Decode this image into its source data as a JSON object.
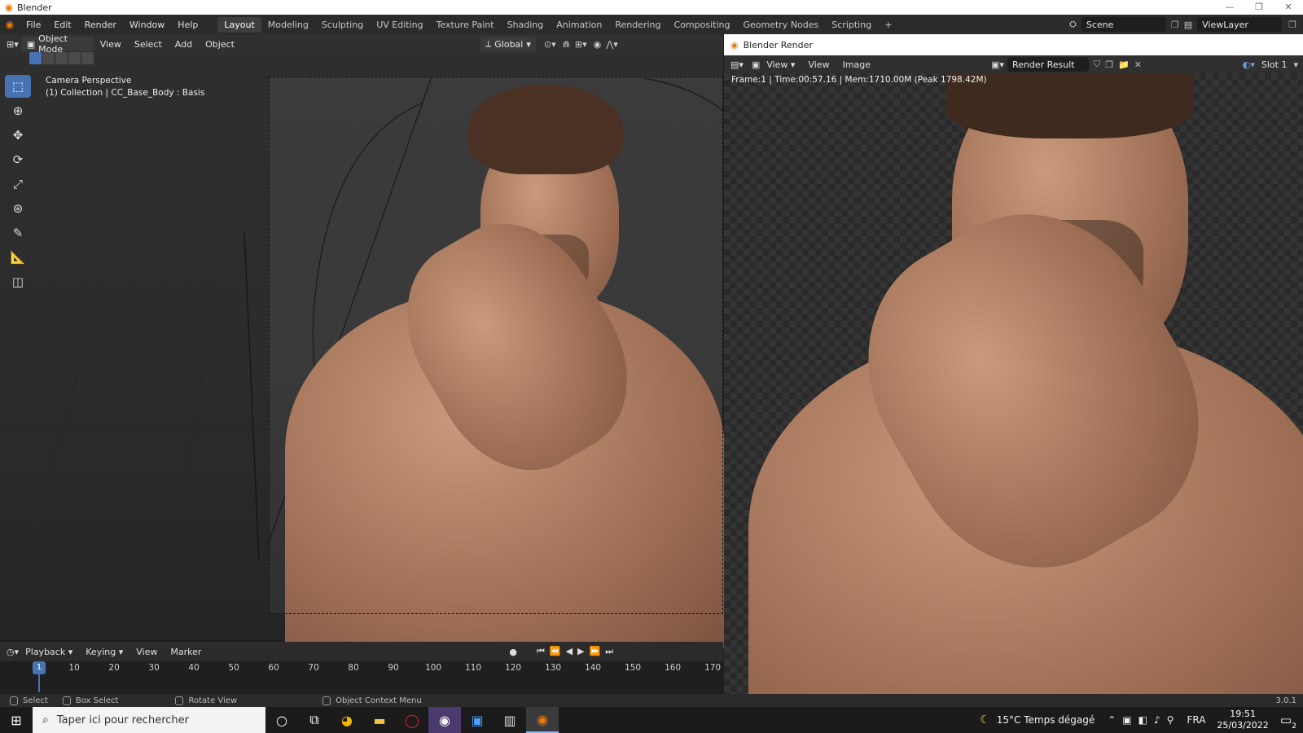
{
  "window": {
    "title": "Blender",
    "minimize": "—",
    "maximize": "❐",
    "close": "✕"
  },
  "menu": [
    "File",
    "Edit",
    "Render",
    "Window",
    "Help"
  ],
  "workspaces": [
    "Layout",
    "Modeling",
    "Sculpting",
    "UV Editing",
    "Texture Paint",
    "Shading",
    "Animation",
    "Rendering",
    "Compositing",
    "Geometry Nodes",
    "Scripting"
  ],
  "active_workspace": "Layout",
  "add_workspace": "+",
  "scene": {
    "name": "Scene",
    "view_layer": "ViewLayer"
  },
  "viewport": {
    "mode": "Object Mode",
    "menus": [
      "View",
      "Select",
      "Add",
      "Object"
    ],
    "orientation": "Global",
    "info_line1": "Camera Perspective",
    "info_line2": "(1) Collection | CC_Base_Body : Basis"
  },
  "render_window": {
    "title": "Blender Render",
    "menus": [
      "View",
      "View",
      "Image"
    ],
    "result": "Render Result",
    "slot": "Slot 1",
    "info": "Frame:1 | Time:00:57.16 | Mem:1710.00M (Peak 1798.42M)"
  },
  "timeline": {
    "menus": [
      "Playback",
      "Keying",
      "View",
      "Marker"
    ],
    "current_frame": "1",
    "ticks": [
      "10",
      "20",
      "30",
      "40",
      "50",
      "60",
      "70",
      "80",
      "90",
      "100",
      "110",
      "120",
      "130",
      "140",
      "150",
      "160",
      "170"
    ]
  },
  "statusbar": {
    "select": "Select",
    "box_select": "Box Select",
    "rotate": "Rotate View",
    "context": "Object Context Menu",
    "version": "3.0.1"
  },
  "taskbar": {
    "search_placeholder": "Taper ici pour rechercher",
    "weather": "15°C  Temps dégagé",
    "lang": "FRA",
    "time": "19:51",
    "date": "25/03/2022",
    "notifications": "2"
  },
  "colors": {
    "accent": "#4772b3",
    "blender_orange": "#e87d0d"
  }
}
